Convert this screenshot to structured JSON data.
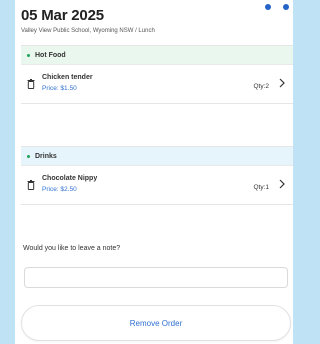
{
  "header": {
    "date": "05 Mar 2025",
    "subtitle": "Valley View Public School, Wyoming NSW / Lunch"
  },
  "sections": [
    {
      "title": "Hot Food",
      "items": [
        {
          "name": "Chicken tender",
          "price": "Price: $1.50",
          "qty": "Qty:2"
        }
      ]
    },
    {
      "title": "Drinks",
      "items": [
        {
          "name": "Chocolate Nippy",
          "price": "Price: $2.50",
          "qty": "Qty:1"
        }
      ]
    }
  ],
  "note": {
    "label": "Would you like to leave a note?",
    "value": "",
    "placeholder": ""
  },
  "actions": {
    "remove_label": "Remove Order"
  },
  "colors": {
    "background": "#bfe3f5",
    "accent_blue": "#2f6fd0",
    "section_bullet": "#1fa35a",
    "drinks_header_bg": "#e6f5fb"
  },
  "icons": {
    "delete": "trash-icon",
    "open": "chevron-right-icon"
  }
}
